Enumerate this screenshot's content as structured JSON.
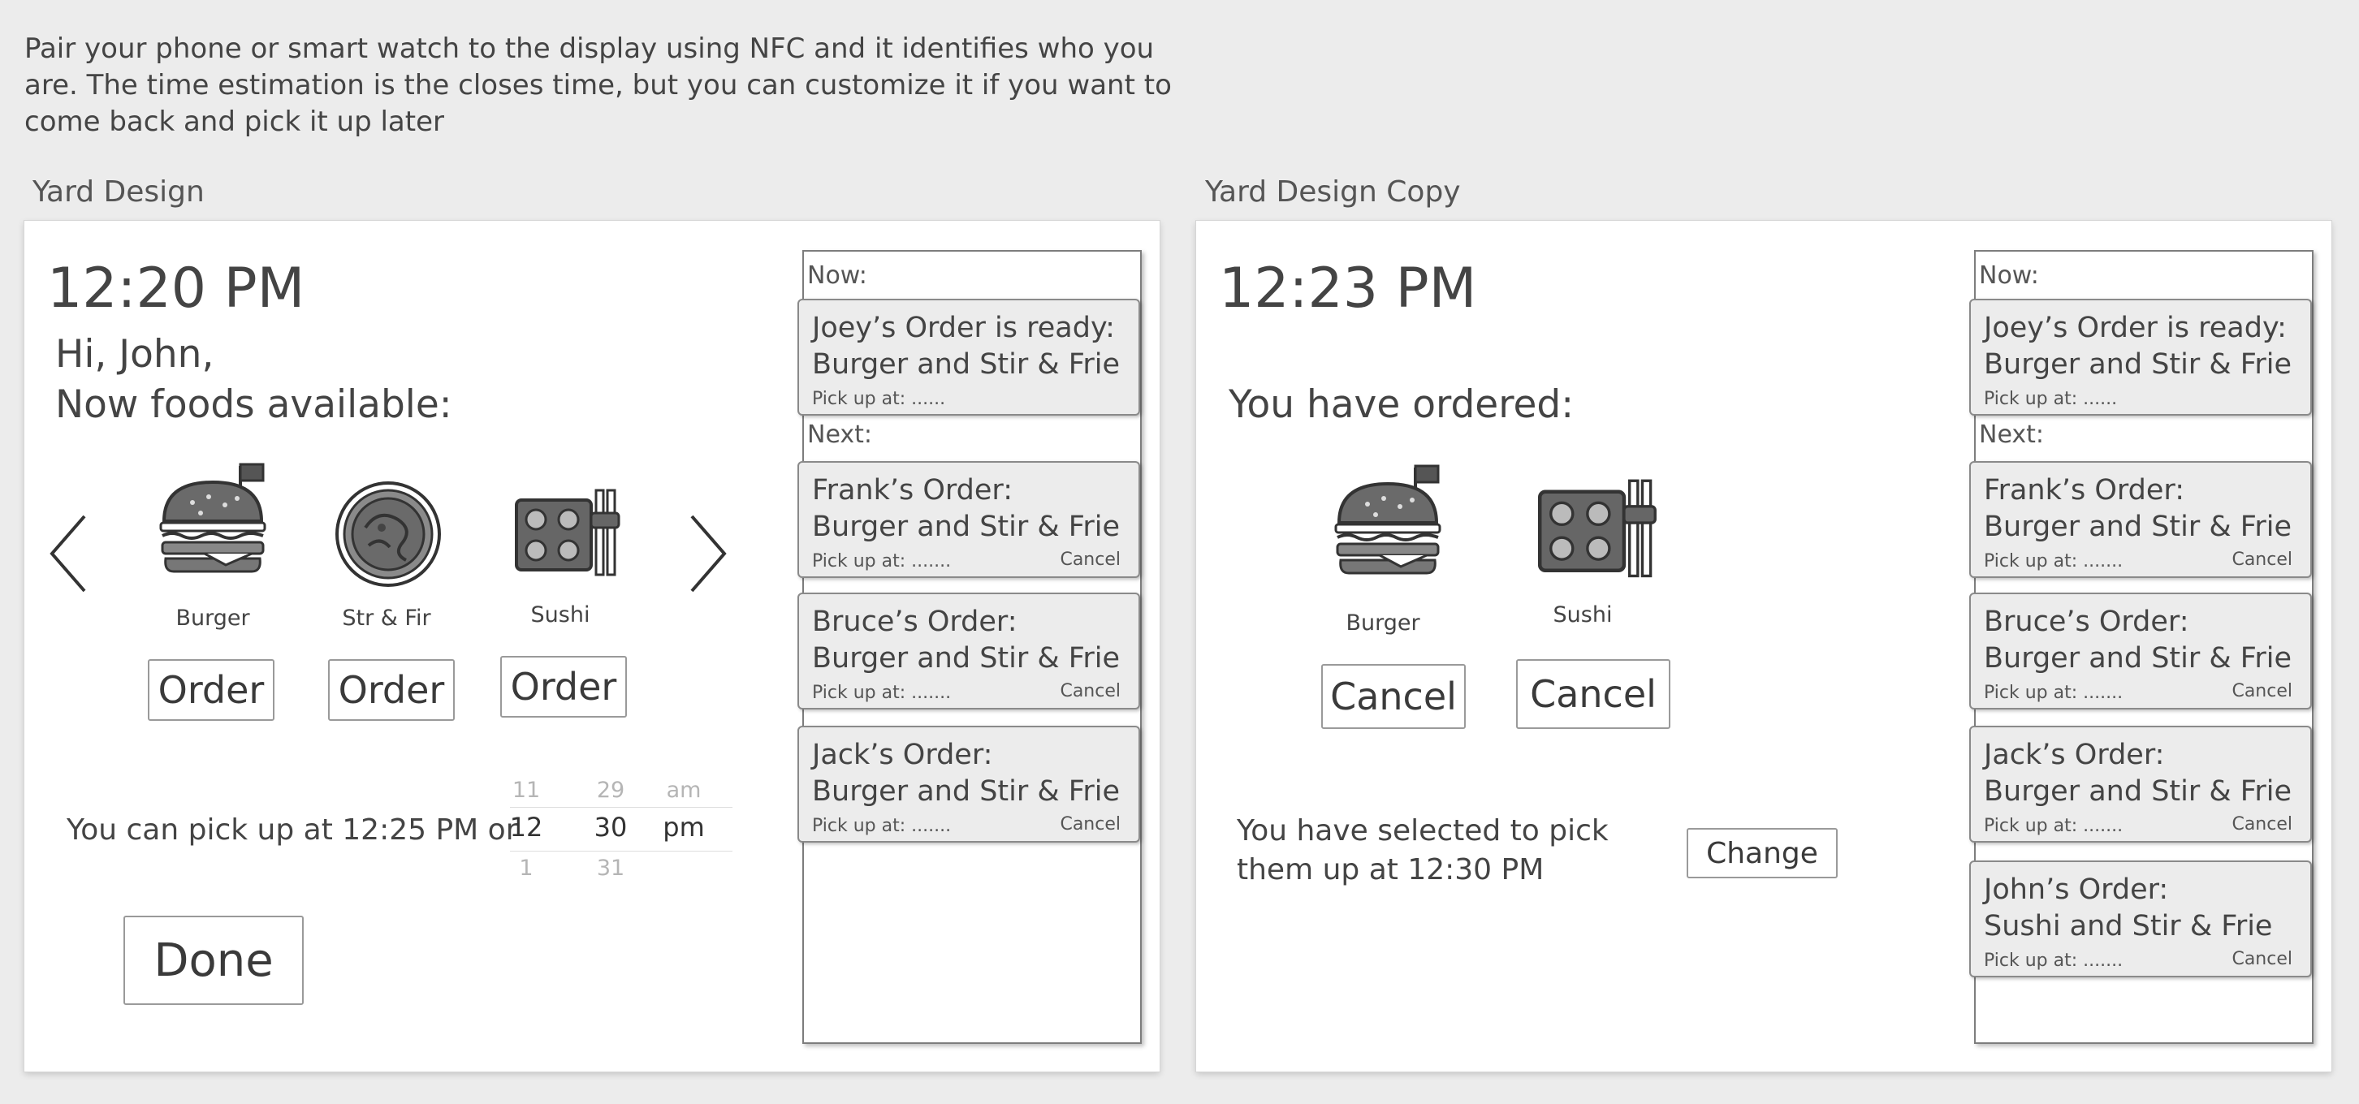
{
  "description": "Pair your phone or smart watch to the display using NFC and it identifies who you are. The time estimation is the closes time, but you can customize it if you want to come back and pick it up later",
  "artboards": [
    {
      "label": "Yard Design",
      "clock": "12:20 PM",
      "greeting_line1": "Hi, John,",
      "greeting_line2": "Now foods available:",
      "foods": [
        {
          "name": "Burger",
          "icon": "burger-icon",
          "button": "Order"
        },
        {
          "name": "Str & Fir",
          "icon": "stir-fry-plate-icon",
          "button": "Order"
        },
        {
          "name": "Sushi",
          "icon": "sushi-icon",
          "button": "Order"
        }
      ],
      "pickup_text": "You can pick up at 12:25 PM or",
      "picker": {
        "hour_prev": "11",
        "hour": "12",
        "hour_next": "1",
        "minute_prev": "29",
        "minute": "30",
        "minute_next": "31",
        "period_prev": "am",
        "period": "pm"
      },
      "done_label": "Done"
    },
    {
      "label": "Yard Design Copy",
      "clock": "12:23 PM",
      "ordered_title": "You have ordered:",
      "foods": [
        {
          "name": "Burger",
          "icon": "burger-icon",
          "button": "Cancel"
        },
        {
          "name": "Sushi",
          "icon": "sushi-icon",
          "button": "Cancel"
        }
      ],
      "selected_line1": "You have selected to pick",
      "selected_line2": "them up at 12:30 PM",
      "change_label": "Change"
    }
  ],
  "queue": {
    "now_label": "Now:",
    "next_label": "Next:",
    "ready_card": {
      "line1": "Joey’s Order is ready:",
      "line2": "Burger and Stir & Frie",
      "pickup": "Pick up at: ......"
    },
    "next_cards": [
      {
        "line1": "Frank’s Order:",
        "line2": "Burger and Stir & Frie",
        "pickup": "Pick up at: .......",
        "cancel": "Cancel"
      },
      {
        "line1": "Bruce’s Order:",
        "line2": "Burger and Stir & Frie",
        "pickup": "Pick up at: .......",
        "cancel": "Cancel"
      },
      {
        "line1": "Jack’s Order:",
        "line2": "Burger and Stir & Frie",
        "pickup": "Pick up at: .......",
        "cancel": "Cancel"
      }
    ],
    "extra_card": {
      "line1": "John’s Order:",
      "line2": "Sushi and Stir & Frie",
      "pickup": "Pick up at: .......",
      "cancel": "Cancel"
    }
  }
}
